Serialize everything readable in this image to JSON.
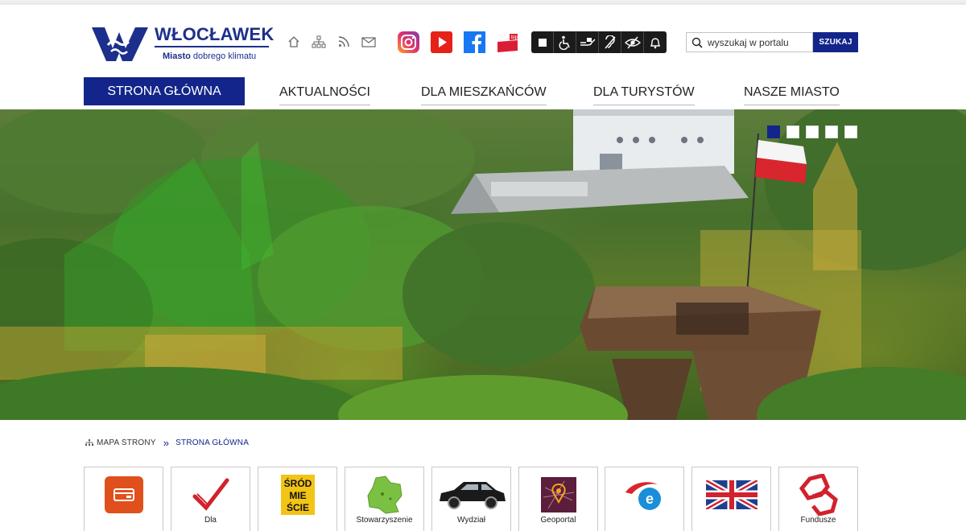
{
  "logo": {
    "name": "WŁOCŁAWEK",
    "tag_bold": "Miasto",
    "tag_rest": " dobrego klimatu"
  },
  "utility_icons": [
    "home-icon",
    "sitemap-icon",
    "rss-icon",
    "mail-icon"
  ],
  "social_icons": [
    "instagram-icon",
    "youtube-icon",
    "facebook-icon",
    "bip-icon"
  ],
  "social_bip_label": "bip",
  "accessibility_icons": [
    "contrast-icon",
    "wheelchair-icon",
    "sign-language-icon",
    "hearing-icon",
    "eye-icon",
    "bell-icon"
  ],
  "search": {
    "placeholder": "wyszukaj w portalu",
    "button": "SZUKAJ"
  },
  "nav": {
    "items": [
      {
        "label": "STRONA GŁÓWNA",
        "active": true
      },
      {
        "label": "AKTUALNOŚCI"
      },
      {
        "label": "DLA MIESZKAŃCÓW"
      },
      {
        "label": "DLA TURYSTÓW"
      },
      {
        "label": "NASZE MIASTO"
      }
    ]
  },
  "hero": {
    "slides": 5,
    "active_slide": 1
  },
  "breadcrumb": {
    "sitemap": "MAPA STRONY",
    "separator": "»",
    "current": "STRONA GŁÓWNA"
  },
  "tiles": [
    {
      "icon": "card-icon",
      "label": ""
    },
    {
      "icon": "checkmark-icon",
      "label": "Dla"
    },
    {
      "icon": "srodmiescie-icon",
      "label": "",
      "badge": "ŚRÓD MIE ŚCIE"
    },
    {
      "icon": "map-region-icon",
      "label": "Stowarzyszenie"
    },
    {
      "icon": "car-icon",
      "label": "Wydział"
    },
    {
      "icon": "geoportal-icon",
      "label": "Geoportal"
    },
    {
      "icon": "epuap-icon",
      "label": ""
    },
    {
      "icon": "uk-flag-icon",
      "label": ""
    },
    {
      "icon": "eu-funds-icon",
      "label": "Fundusze"
    }
  ],
  "colors": {
    "brand": "#13258a",
    "dark": "#1b1b1b"
  }
}
